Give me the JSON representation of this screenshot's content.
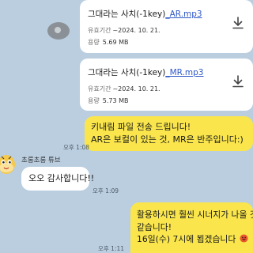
{
  "messages": {
    "file1": {
      "prefix": "그대라는 사치(-1key)",
      "link": "_AR.mp3",
      "expiry_label": "유효기간",
      "expiry_value": "~2024. 10. 21.",
      "size_label": "용량",
      "size_value": "5.69 MB"
    },
    "file2": {
      "prefix": "그대라는 사치(-1key)",
      "link": "_MR.mp3",
      "expiry_label": "유효기간",
      "expiry_value": "~2024. 10. 21.",
      "size_label": "용량",
      "size_value": "5.73 MB"
    },
    "msg1": {
      "line1": "키내림 파일 전송 드립니다!",
      "line2": "AR은 보컬이 있는 것, MR은 반주입니다:)",
      "time": "오후 1:08"
    },
    "reply": {
      "sender": "초롱초롱 튜브",
      "text": "오오 감사합니다!!",
      "time": "오후 1:09"
    },
    "msg2": {
      "line1": "활용하시면 훨씬 시너지가 나올 것",
      "line2": "같습니다!",
      "line3": "16일(수) 7시에 뵙겠습니다",
      "time": "오후 1:11"
    }
  },
  "colors": {
    "background": "#bacee0",
    "my_bubble": "#fae64c",
    "their_bubble": "#ffffff",
    "link": "#2f58c8"
  }
}
